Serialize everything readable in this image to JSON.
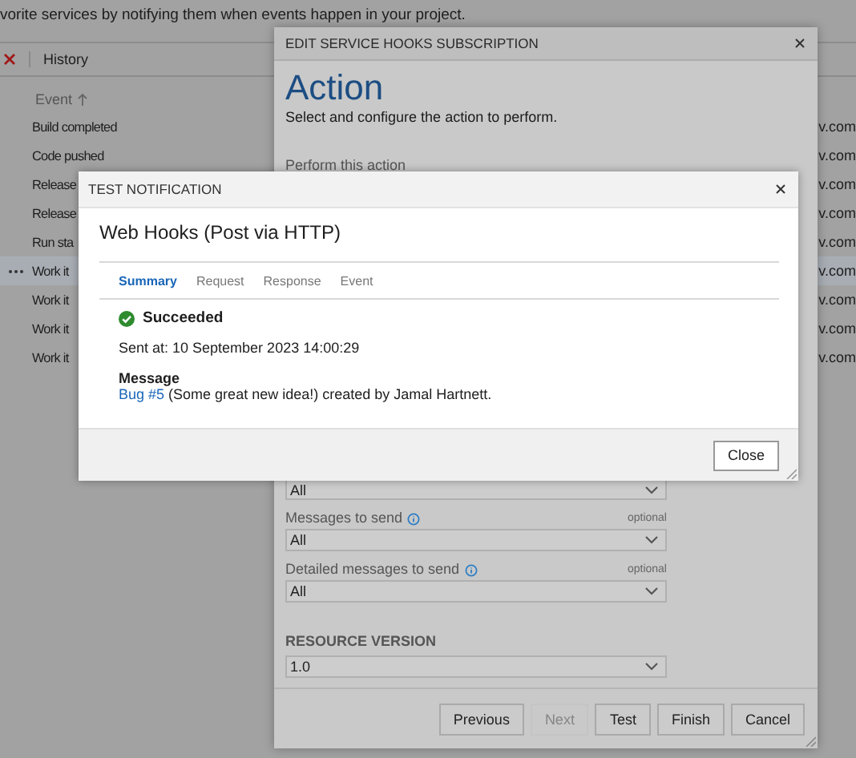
{
  "page": {
    "intro": "vorite services by notifying them when events happen in your project.",
    "toolbar": {
      "history": "History"
    },
    "table": {
      "column_1": "Event",
      "rows": [
        {
          "event": "Build completed",
          "column_2": "v.com",
          "selected": false
        },
        {
          "event": "Code pushed",
          "column_2": "v.com",
          "selected": false
        },
        {
          "event": "Release",
          "column_2": "v.com",
          "selected": false
        },
        {
          "event": "Release",
          "column_2": "v.com",
          "selected": false
        },
        {
          "event": "Run sta",
          "column_2": "v.com",
          "selected": false
        },
        {
          "event": "Work it",
          "column_2": "v.com",
          "selected": true
        },
        {
          "event": "Work it",
          "column_2": "v.com",
          "selected": false
        },
        {
          "event": "Work it",
          "column_2": "v.com",
          "selected": false
        },
        {
          "event": "Work it",
          "column_2": "v.com",
          "selected": false
        }
      ]
    }
  },
  "edit_dialog": {
    "title": "EDIT SERVICE HOOKS SUBSCRIPTION",
    "heading": "Action",
    "subtitle": "Select and configure the action to perform.",
    "perform_label": "Perform this action",
    "fields": [
      {
        "value": "All"
      },
      {
        "label": "Messages to send",
        "optional": "optional",
        "info": true,
        "value": "All"
      },
      {
        "label": "Detailed messages to send",
        "optional": "optional",
        "info": true,
        "value": "All"
      }
    ],
    "resource_version": {
      "label": "RESOURCE VERSION",
      "value": "1.0"
    },
    "buttons": [
      {
        "label": "Previous",
        "disabled": false
      },
      {
        "label": "Next",
        "disabled": true
      },
      {
        "label": "Test",
        "disabled": false
      },
      {
        "label": "Finish",
        "disabled": false
      },
      {
        "label": "Cancel",
        "disabled": false
      }
    ]
  },
  "test_dialog": {
    "title": "TEST NOTIFICATION",
    "service": "Web Hooks (Post via HTTP)",
    "tabs": [
      {
        "label": "Summary",
        "selected": true
      },
      {
        "label": "Request",
        "selected": false
      },
      {
        "label": "Response",
        "selected": false
      },
      {
        "label": "Event",
        "selected": false
      }
    ],
    "status": "Succeeded",
    "sent_at": "Sent at: 10 September 2023 14:00:29",
    "message_label": "Message",
    "message_link": "Bug #5",
    "message_text": "(Some great new idea!) created by Jamal Hartnett.",
    "close_button": "Close"
  }
}
